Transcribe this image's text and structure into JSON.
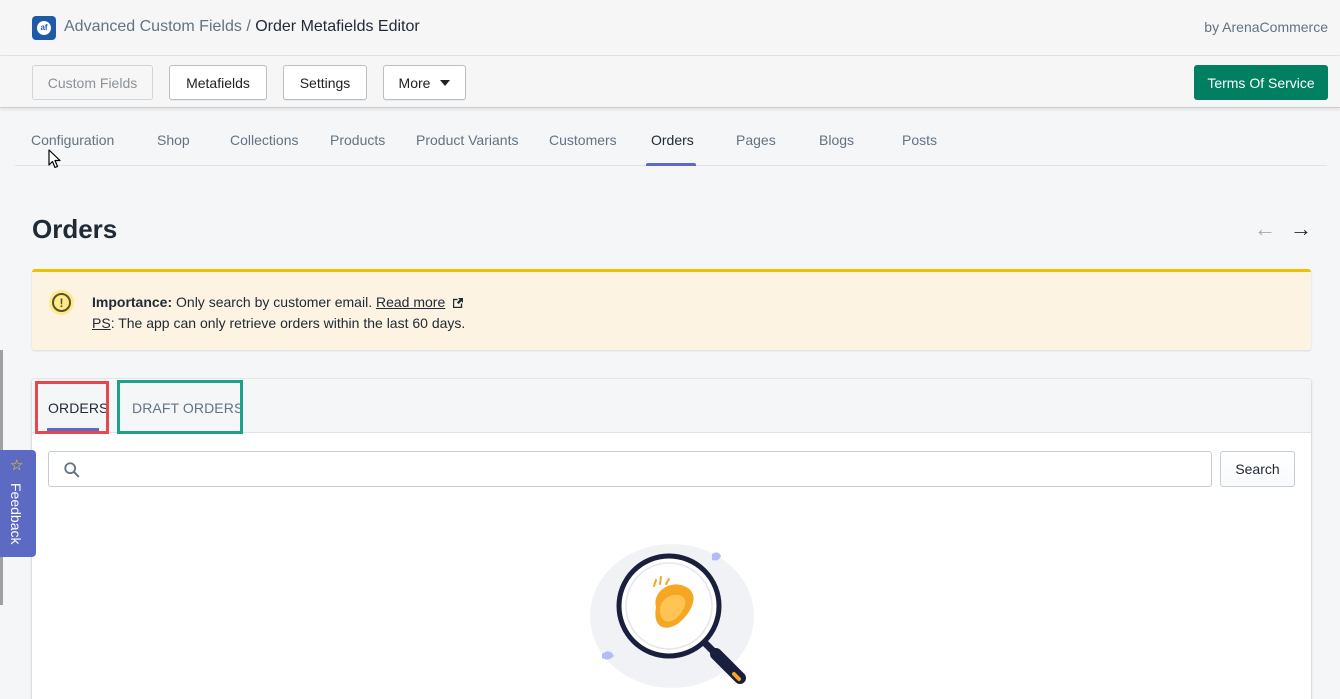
{
  "app": {
    "name": "Advanced Custom Fields",
    "separator": "/",
    "page": "Order Metafields Editor",
    "by": "by ArenaCommerce",
    "logo_icon": "acf-logo-icon"
  },
  "toolbar": {
    "custom_fields": "Custom Fields",
    "metafields": "Metafields",
    "settings": "Settings",
    "more": "More",
    "terms": "Terms Of Service"
  },
  "nav": {
    "tabs": [
      "Configuration",
      "Shop",
      "Collections",
      "Products",
      "Product Variants",
      "Customers",
      "Orders",
      "Pages",
      "Blogs",
      "Posts"
    ],
    "active": "Orders"
  },
  "page": {
    "title": "Orders",
    "prev_icon": "arrow-left-icon",
    "next_icon": "arrow-right-icon"
  },
  "banner": {
    "importance_label": "Importance:",
    "importance_text": " Only search by customer email. ",
    "read_more": "Read more",
    "ps_label": "PS",
    "ps_text": ": The app can only retrieve orders within the last 60 days."
  },
  "card": {
    "tabs": [
      "ORDERS",
      "DRAFT ORDERS"
    ],
    "active_tab": "ORDERS",
    "search_value": "",
    "search_button": "Search"
  },
  "feedback": {
    "label": "Feedback",
    "icon": "star-icon"
  },
  "colors": {
    "primary": "#008060",
    "accent": "#5c6ac4",
    "warning_border": "#eec200",
    "warning_bg": "#fcf3e2",
    "highlight_red": "#e5484d",
    "highlight_green": "#1fa187"
  }
}
